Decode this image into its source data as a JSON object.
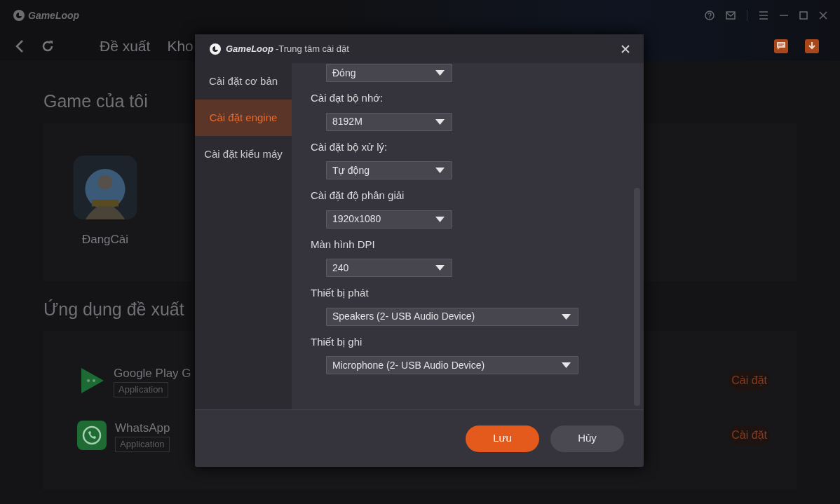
{
  "app": {
    "logo": "GameLoop",
    "nav_tabs": [
      "Đề xuất",
      "Kho"
    ]
  },
  "my_games": {
    "title": "Game của tôi",
    "games": [
      {
        "name": "ĐangCài"
      }
    ]
  },
  "recommended": {
    "title": "Ứng dụng đề xuất",
    "apps": [
      {
        "name": "Google Play G",
        "tag": "Application",
        "kind": "game",
        "action": "Cài đặt"
      },
      {
        "name": "WhatsApp",
        "tag": "Application",
        "kind": "messenger",
        "action": "Cài đặt"
      }
    ]
  },
  "dialog": {
    "brand": "GameLoop",
    "title": "-Trung tâm cài đặt",
    "sidebar": [
      {
        "label": "Cài đặt cơ bản",
        "selected": false
      },
      {
        "label": "Cài đặt engine",
        "selected": true
      },
      {
        "label": "Cài đặt kiểu máy",
        "selected": false
      }
    ],
    "settings": [
      {
        "kind": "dropdown",
        "value": "Đóng"
      },
      {
        "kind": "dropdown",
        "label": "Cài đạt bộ nhớ:",
        "value": "8192M"
      },
      {
        "kind": "dropdown",
        "label": "Cài đặt bộ xử lý:",
        "value": "Tự động"
      },
      {
        "kind": "dropdown",
        "label": "Cài đặt độ phân giải",
        "value": "1920x1080"
      },
      {
        "kind": "dropdown",
        "label": "Màn hình DPI",
        "value": "240"
      },
      {
        "kind": "wide-dropdown",
        "label": "Thiết bị phát",
        "value": "Speakers (2- USB Audio Device)"
      },
      {
        "kind": "wide-dropdown",
        "label": "Thiết bị ghi",
        "value": "Microphone (2- USB Audio Device)"
      }
    ],
    "buttons": [
      {
        "kind": "primary",
        "label": "Lưu"
      },
      {
        "kind": "secondary",
        "label": "Hủy"
      }
    ]
  }
}
